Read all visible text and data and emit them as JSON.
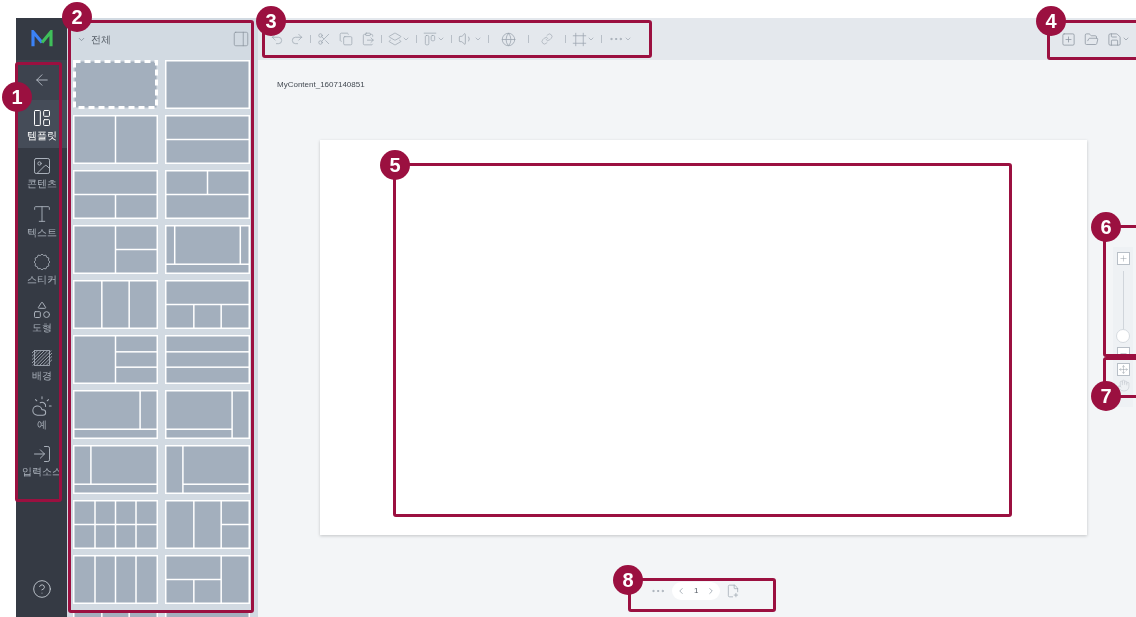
{
  "sidebar": {
    "items": [
      {
        "kind": "template",
        "label": "템플릿",
        "selected": true
      },
      {
        "kind": "content",
        "label": "콘텐츠",
        "selected": false
      },
      {
        "kind": "text",
        "label": "텍스트",
        "selected": false
      },
      {
        "kind": "sticker",
        "label": "스티커",
        "selected": false
      },
      {
        "kind": "shape",
        "label": "도형",
        "selected": false
      },
      {
        "kind": "background",
        "label": "배경",
        "selected": false
      },
      {
        "kind": "weather",
        "label": "예",
        "selected": false
      },
      {
        "kind": "input",
        "label": "입력소스",
        "selected": false
      }
    ]
  },
  "template_panel": {
    "filter": "전체"
  },
  "document": {
    "title": "MyContent_1607140851"
  },
  "zoom": {
    "level": 0
  },
  "pagination": {
    "page": "1"
  },
  "callouts": [
    {
      "label": "1"
    },
    {
      "label": "2"
    },
    {
      "label": "3"
    },
    {
      "label": "4"
    },
    {
      "label": "5"
    },
    {
      "label": "6"
    },
    {
      "label": "7"
    },
    {
      "label": "8"
    }
  ]
}
